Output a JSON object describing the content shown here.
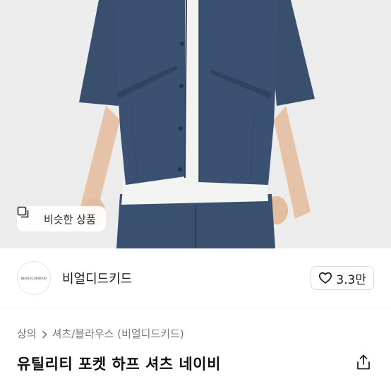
{
  "product_image": {
    "similar_button_label": "비슷한 상품",
    "similar_icon": "similar-products-icon"
  },
  "shop": {
    "logo_text": "BEARDCURBIKID",
    "name": "비얼디드키드",
    "like_count": "3.3만",
    "like_icon": "heart-outline-icon"
  },
  "breadcrumb": {
    "items": [
      "상의",
      "셔츠/블라우스 (비얼디드키드)"
    ],
    "separator_icon": "chevron-right-icon"
  },
  "product": {
    "title": "유틸리티 포켓 하프 셔츠 네이비",
    "share_icon": "share-icon"
  },
  "colors": {
    "shirt": "#3b5171",
    "background": "#ededed"
  }
}
